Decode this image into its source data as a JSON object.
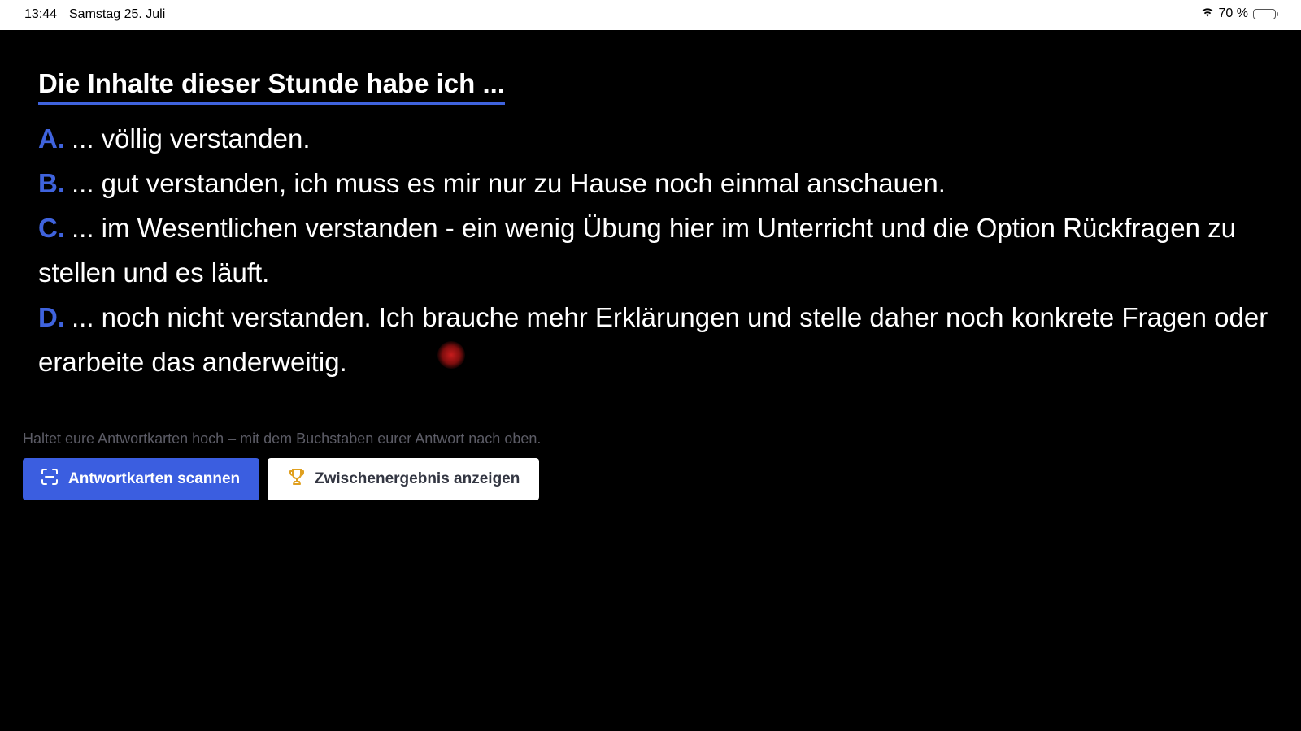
{
  "status_bar": {
    "time": "13:44",
    "date": "Samstag 25. Juli",
    "battery_text": "70 %",
    "battery_level": 0.7
  },
  "question": "Die Inhalte dieser Stunde habe ich ...",
  "options": [
    {
      "letter": "A.",
      "text": "... völlig verstanden."
    },
    {
      "letter": "B.",
      "text": "... gut verstanden, ich muss es mir nur zu Hause noch einmal anschauen."
    },
    {
      "letter": "C.",
      "text": "... im Wesentlichen verstanden - ein wenig Übung hier im Unterricht und die Option Rückfragen zu stellen und es läuft."
    },
    {
      "letter": "D.",
      "text": "... noch nicht verstanden. Ich brauche mehr Erklärungen und stelle daher noch konkrete Fragen oder erarbeite das anderweitig."
    }
  ],
  "hint": "Haltet eure Antwortkarten hoch – mit dem Buchstaben eurer Antwort nach oben.",
  "buttons": {
    "scan_label": "Antwortkarten scannen",
    "result_label": "Zwischenergebnis anzeigen"
  },
  "colors": {
    "accent": "#3f63dd",
    "background": "#000000",
    "trophy": "#e0a020"
  },
  "icons": {
    "scan": "scan-frame-icon",
    "result": "trophy-icon",
    "wifi": "wifi-icon",
    "battery": "battery-icon"
  }
}
